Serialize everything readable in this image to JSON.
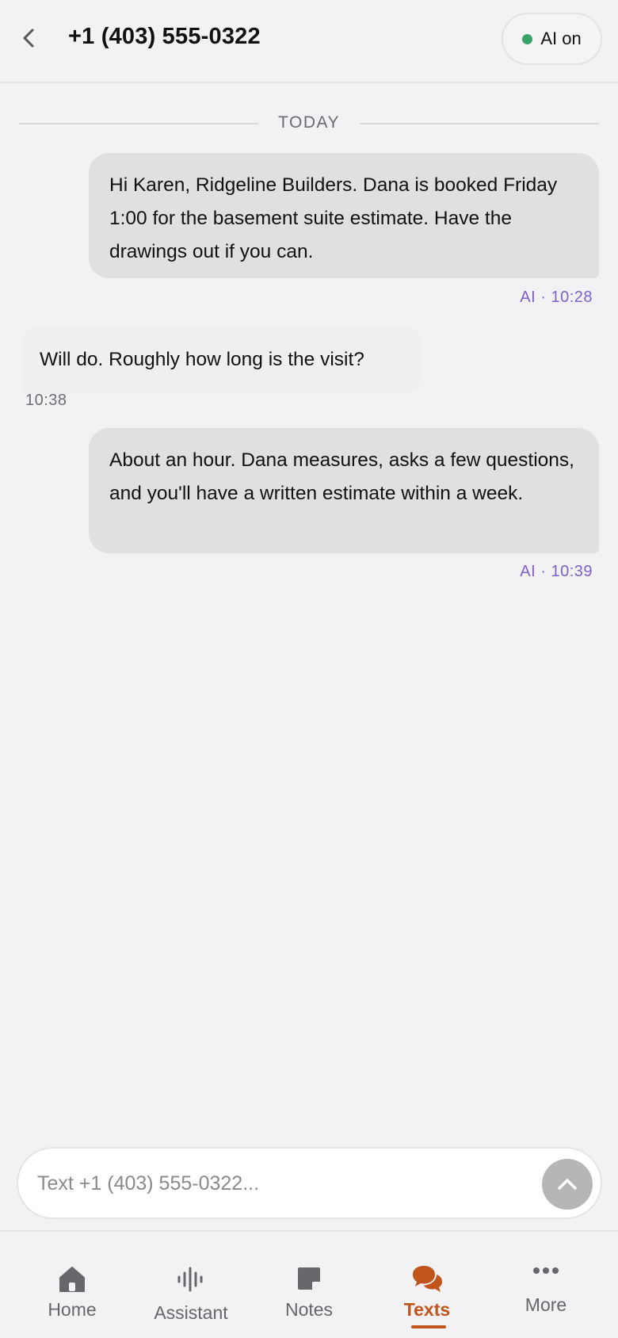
{
  "header": {
    "title": "+1 (403) 555-0322",
    "ai_toggle_label": "AI on",
    "ai_status_color": "#3aa36a"
  },
  "thread": {
    "date_divider": "TODAY",
    "messages": [
      {
        "direction": "outgoing",
        "text": "Hi Karen, Ridgeline Builders. Dana is booked Friday 1:00 for the basement suite estimate. Have the drawings out if you can.",
        "meta": "AI · 10:28"
      },
      {
        "direction": "incoming",
        "text": "Will do. Roughly how long is the visit?",
        "meta": "10:38"
      },
      {
        "direction": "outgoing",
        "text": "About an hour. Dana measures, asks a few questions, and you'll have a written estimate within a week.",
        "meta": "AI · 10:39"
      }
    ]
  },
  "composer": {
    "placeholder": "Text +1 (403) 555-0322...",
    "value": ""
  },
  "nav": {
    "items": [
      {
        "label": "Home",
        "icon": "home-icon"
      },
      {
        "label": "Assistant",
        "icon": "waveform-icon"
      },
      {
        "label": "Notes",
        "icon": "note-icon"
      },
      {
        "label": "Texts",
        "icon": "chat-bubbles-icon",
        "active": true
      },
      {
        "label": "More",
        "icon": "more-dots-icon"
      }
    ],
    "active_color": "#c0541a"
  }
}
